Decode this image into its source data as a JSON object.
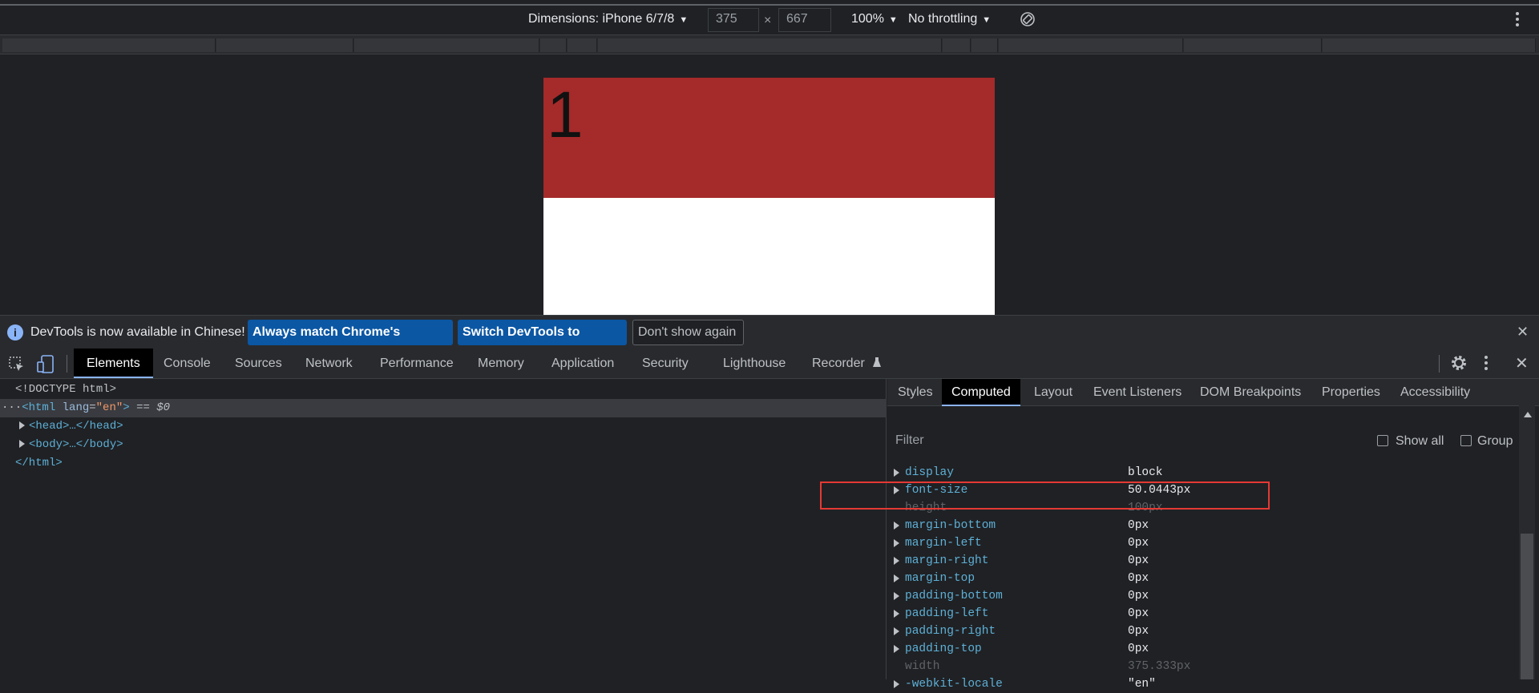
{
  "device_toolbar": {
    "dimensions_label": "Dimensions: iPhone 6/7/8",
    "width": "375",
    "height": "667",
    "times": "×",
    "zoom": "100%",
    "throttling": "No throttling"
  },
  "viewport": {
    "box_text": "1",
    "box_color": "#a52a2a"
  },
  "infobar": {
    "message": "DevTools is now available in Chinese!",
    "btn_match": "Always match Chrome's language",
    "btn_switch": "Switch DevTools to Chinese",
    "btn_dont": "Don't show again"
  },
  "tabs": [
    "Elements",
    "Console",
    "Sources",
    "Network",
    "Performance",
    "Memory",
    "Application",
    "Security",
    "Lighthouse",
    "Recorder"
  ],
  "elements_panel": {
    "doctype": "<!DOCTYPE html>",
    "html_open": "<html",
    "lang_attr": "lang",
    "lang_val": "\"en\"",
    "html_close_bracket": ">",
    "eq_ref": " == $0",
    "head": "<head>…</head>",
    "body": "<body>…</body>",
    "html_end": "</html>"
  },
  "side_tabs": [
    "Styles",
    "Computed",
    "Layout",
    "Event Listeners",
    "DOM Breakpoints",
    "Properties",
    "Accessibility"
  ],
  "filter": {
    "placeholder": "Filter",
    "show_all": "Show all",
    "group": "Group"
  },
  "computed": [
    {
      "name": "display",
      "value": "block"
    },
    {
      "name": "font-size",
      "value": "50.0443px"
    },
    {
      "name": "height",
      "value": "100px"
    },
    {
      "name": "margin-bottom",
      "value": "0px"
    },
    {
      "name": "margin-left",
      "value": "0px"
    },
    {
      "name": "margin-right",
      "value": "0px"
    },
    {
      "name": "margin-top",
      "value": "0px"
    },
    {
      "name": "padding-bottom",
      "value": "0px"
    },
    {
      "name": "padding-left",
      "value": "0px"
    },
    {
      "name": "padding-right",
      "value": "0px"
    },
    {
      "name": "padding-top",
      "value": "0px"
    },
    {
      "name": "width",
      "value": "375.333px"
    },
    {
      "name": "-webkit-locale",
      "value": "\"en\""
    }
  ],
  "colors": {
    "accent": "#8ab4f8",
    "button_blue": "#0b57a4",
    "highlight": "#e53935"
  }
}
